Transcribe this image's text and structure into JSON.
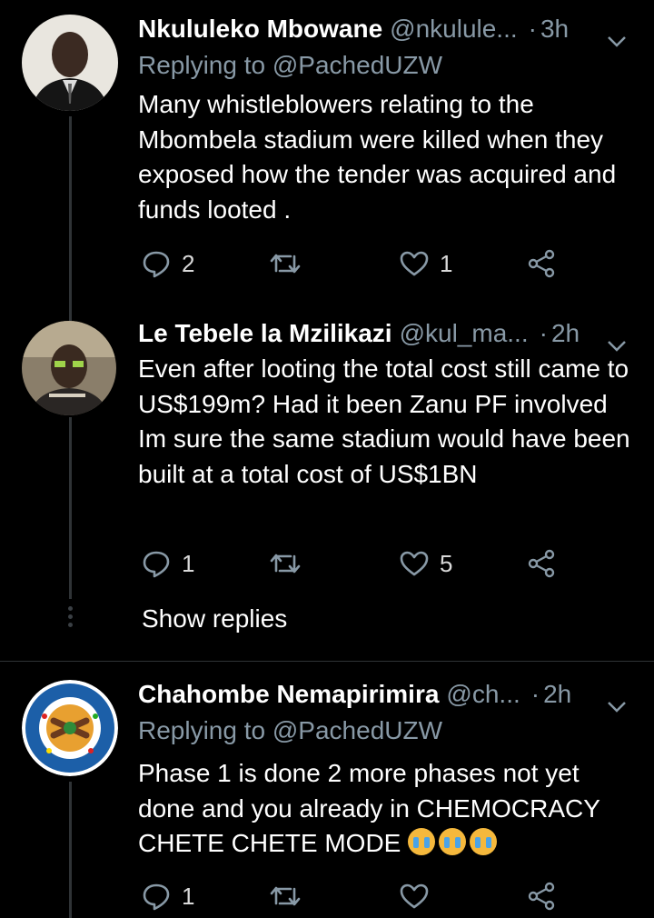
{
  "tweets": [
    {
      "name": "Nkululeko Mbowane",
      "handle": "@nkulule...",
      "dot": "·",
      "time": "3h",
      "reply_prefix": "Replying to",
      "reply_mention": "@PachedUZW",
      "text": "Many whistleblowers relating to the Mbombela stadium were killed when they exposed how the tender was acquired and funds looted .",
      "replies": "2",
      "retweets": "",
      "likes": "1"
    },
    {
      "name": "Le Tebele la Mzilikazi",
      "handle": "@kul_ma...",
      "dot": "·",
      "time": "2h",
      "text": "Even after looting the total cost still came to US$199m? Had it been Zanu PF involved Im sure the same stadium would have been built at a total cost of US$1BN",
      "replies": "1",
      "retweets": "",
      "likes": "5"
    },
    {
      "name": "Chahombe Nemapirimira",
      "handle": "@ch...",
      "dot": "·",
      "time": "2h",
      "reply_prefix": "Replying to",
      "reply_mention": "@PachedUZW",
      "text": "Phase 1 is done 2 more phases not yet done and you already in CHEMOCRACY CHETE CHETE MODE",
      "replies": "1",
      "retweets": "",
      "likes": ""
    }
  ],
  "show_replies": "Show replies",
  "colors": {
    "background": "#000000",
    "muted": "#8899a6",
    "text": "#ffffff",
    "divider": "#2f3336"
  }
}
